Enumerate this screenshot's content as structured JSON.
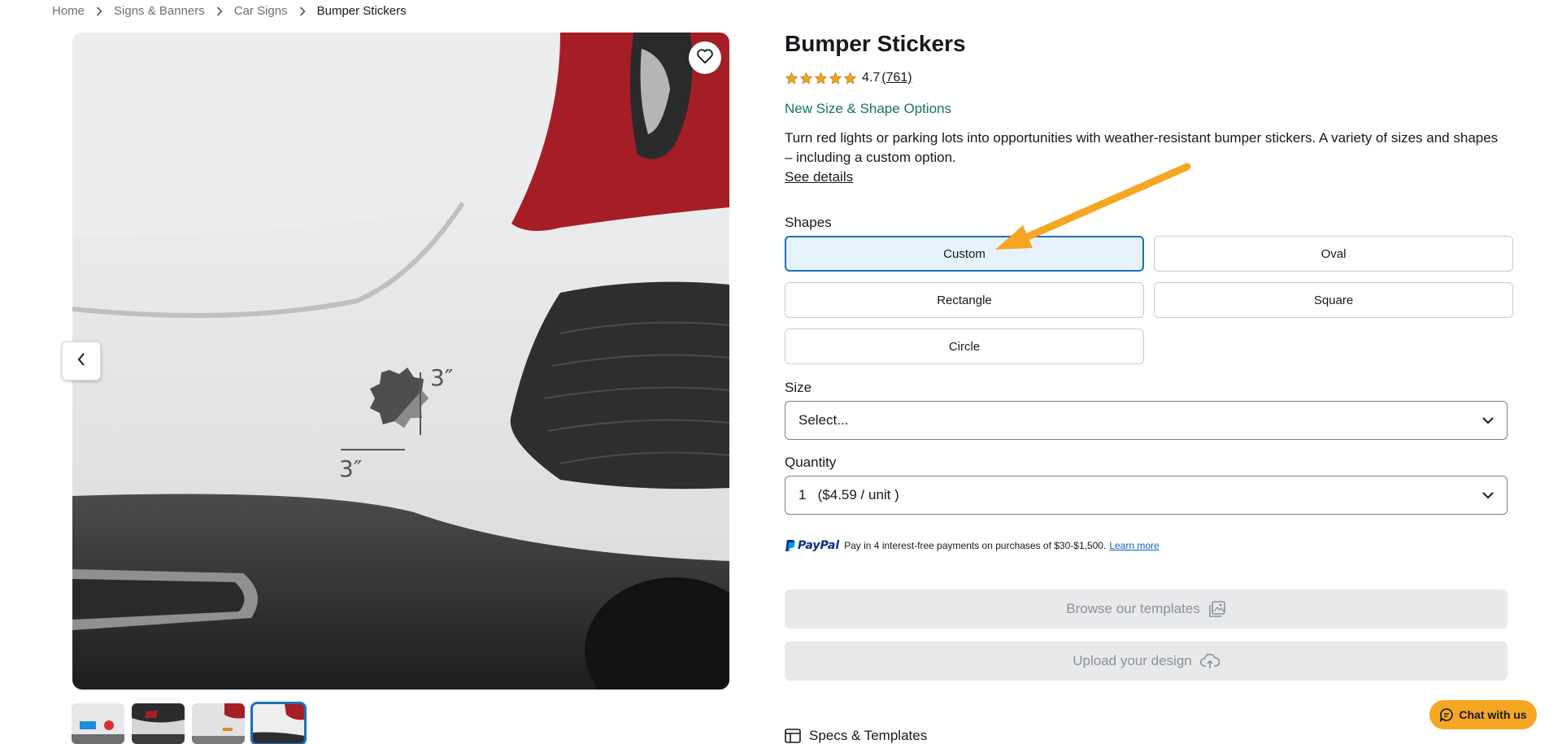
{
  "breadcrumb": {
    "items": [
      "Home",
      "Signs & Banners",
      "Car Signs"
    ],
    "current": "Bumper Stickers"
  },
  "gallery": {
    "dimension_vertical": "3″",
    "dimension_horizontal": "3″",
    "thumbnail_count": 4,
    "active_thumbnail": 4
  },
  "product": {
    "title": "Bumper Stickers",
    "rating": {
      "score": "4.7",
      "count": "(761)",
      "stars": 5
    },
    "promo": "New Size & Shape Options",
    "description": "Turn red lights or parking lots into opportunities with weather-resistant bumper stickers. A variety of sizes and shapes – including a custom option.",
    "details_link": "See details"
  },
  "shapes": {
    "label": "Shapes",
    "options": [
      "Custom",
      "Oval",
      "Rectangle",
      "Square",
      "Circle"
    ],
    "selected": "Custom"
  },
  "size": {
    "label": "Size",
    "value": "Select..."
  },
  "quantity": {
    "label": "Quantity",
    "value": "1   ($4.59 / unit )"
  },
  "paypal": {
    "logo": "PayPal",
    "text": "Pay in 4 interest-free payments on purchases of $30-$1,500.",
    "link": "Learn more"
  },
  "actions": {
    "browse_templates": "Browse our templates",
    "upload_design": "Upload your design"
  },
  "specs": {
    "label": "Specs & Templates"
  },
  "chat": {
    "label": "Chat with us"
  },
  "colors": {
    "accent": "#1e6fb8",
    "selected_bg": "#e6f3fc",
    "promo_green": "#16794d",
    "star": "#f0a31c",
    "chat_bg": "#f5a623",
    "annotation_arrow": "#f5a623"
  },
  "icons": [
    "chevron-right-icon",
    "heart-icon",
    "chevron-left-icon",
    "chevron-down-icon",
    "image-gallery-icon",
    "upload-cloud-icon",
    "table-icon",
    "chat-bubble-icon"
  ]
}
